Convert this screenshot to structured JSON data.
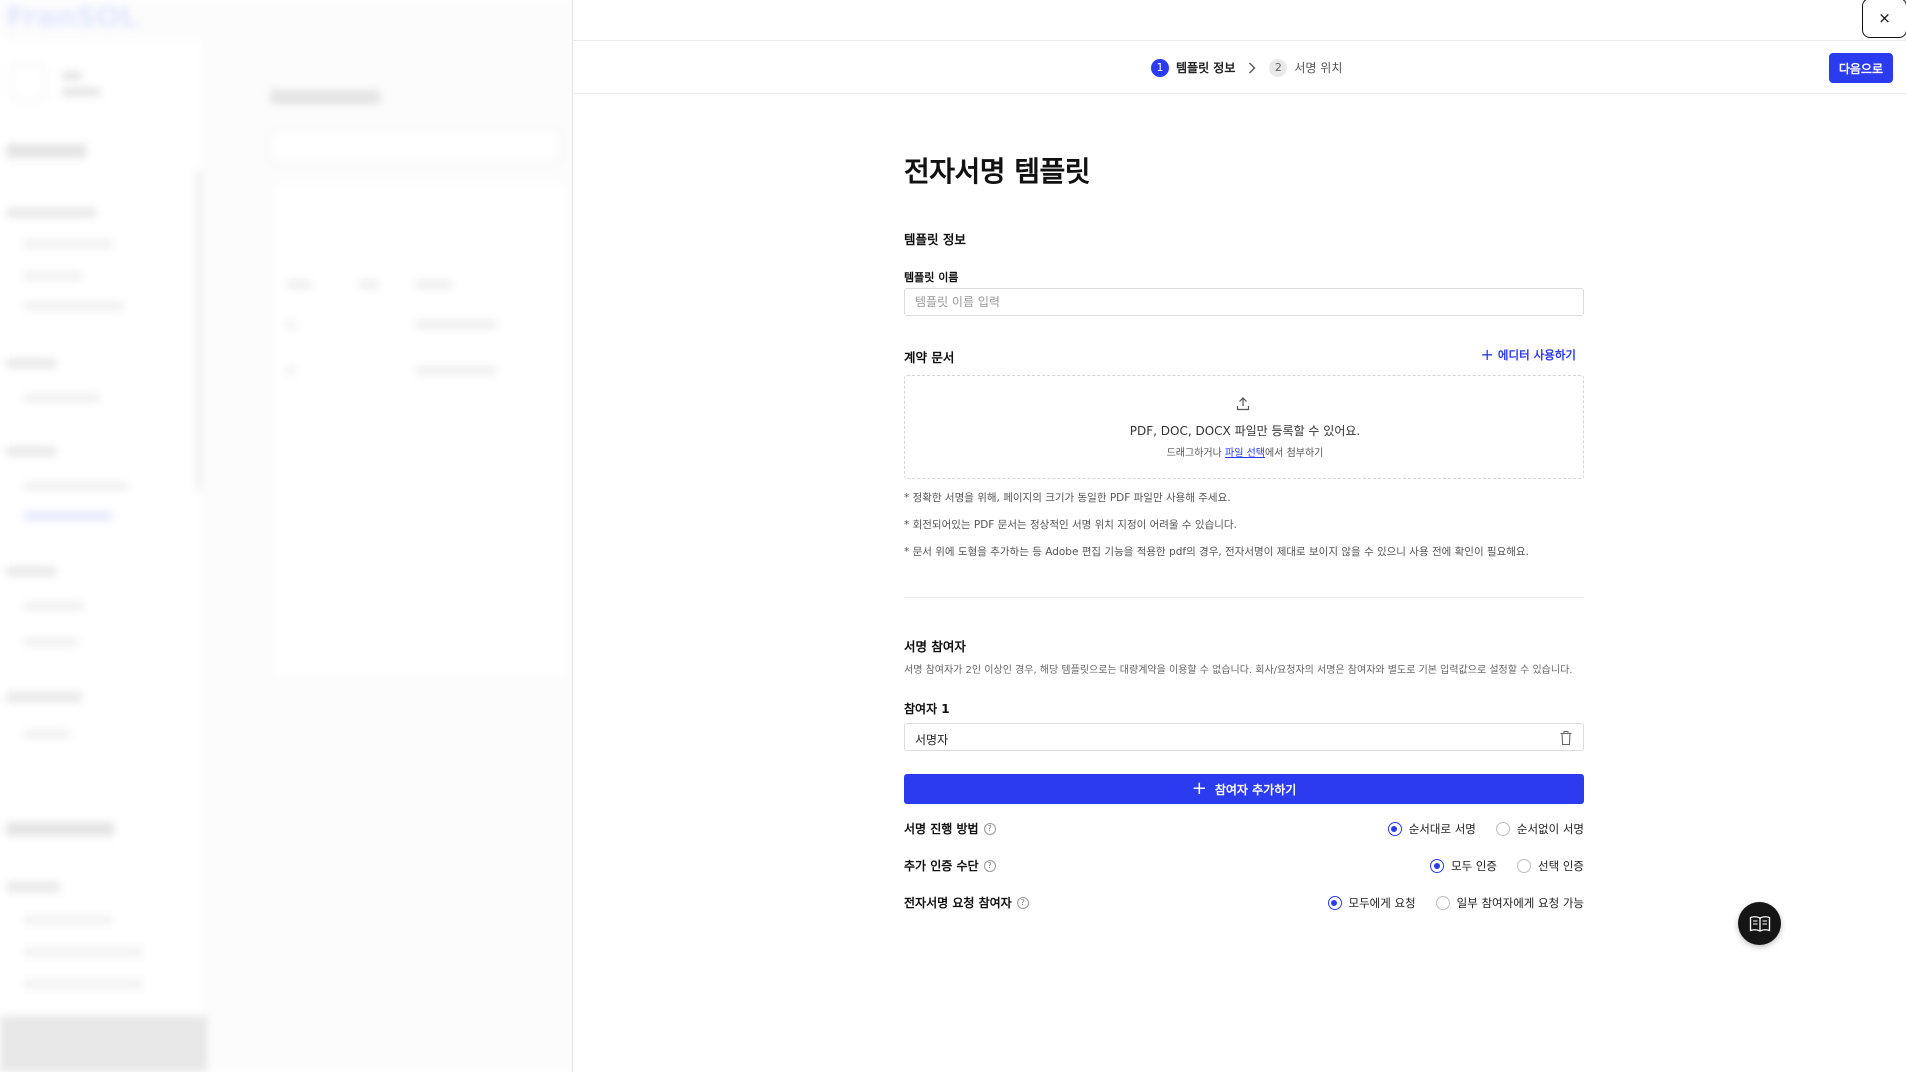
{
  "background": {
    "logo": "FranSOL"
  },
  "drawer": {
    "close_label": "×",
    "steps": [
      {
        "number": "1",
        "label": "템플릿 정보"
      },
      {
        "number": "2",
        "label": "서명 위치"
      }
    ],
    "next_label": "다음으로",
    "page_title": "전자서명 템플릿",
    "template_info": {
      "section_label": "템플릿 정보",
      "name_label": "템플릿 이름",
      "name_placeholder": "템플릿 이름 입력",
      "name_value": ""
    },
    "contract_doc": {
      "section_label": "계약 문서",
      "editor_link": "에디터 사용하기",
      "dropzone_main": "PDF, DOC, DOCX 파일만 등록할 수 있어요.",
      "dropzone_sub_before": "드래그하거나 ",
      "dropzone_sub_link": "파일 선택",
      "dropzone_sub_after": "에서 첨부하기",
      "notes": [
        "* 정확한 서명을 위해, 페이지의 크기가 동일한 PDF 파일만 사용해 주세요.",
        "* 회전되어있는 PDF 문서는 정상적인 서명 위치 지정이 어려울 수 있습니다.",
        "* 문서 위에 도형을 추가하는 등 Adobe 편집 기능을 적용한 pdf의 경우, 전자서명이 제대로 보이지 않을 수 있으니 사용 전에 확인이 필요해요."
      ]
    },
    "participants": {
      "section_label": "서명 참여자",
      "description": "서명 참여자가 2인 이상인 경우, 해당 템플릿으로는 대량계약을 이용할 수 없습니다. 회사/요청자의 서명은 참여자와 별도로 기본 입력값으로 설정할 수 있습니다.",
      "participant_label": "참여자 1",
      "participant_value": "서명자",
      "add_label": "참여자 추가하기"
    },
    "options": [
      {
        "label": "서명 진행 방법",
        "choices": [
          "순서대로 서명",
          "순서없이 서명"
        ],
        "selected": 0
      },
      {
        "label": "추가 인증 수단",
        "choices": [
          "모두 인증",
          "선택 인증"
        ],
        "selected": 0
      },
      {
        "label": "전자서명 요청 참여자",
        "choices": [
          "모두에게 요청",
          "일부 참여자에게 요청 가능"
        ],
        "selected": 0
      }
    ],
    "help_glyph": "?"
  },
  "colors": {
    "accent": "#2b3bf0",
    "fab": "#151515"
  },
  "icons": [
    "close-icon",
    "chevron-right-icon",
    "upload-icon",
    "plus-icon",
    "trash-icon",
    "help-icon",
    "book-icon"
  ]
}
